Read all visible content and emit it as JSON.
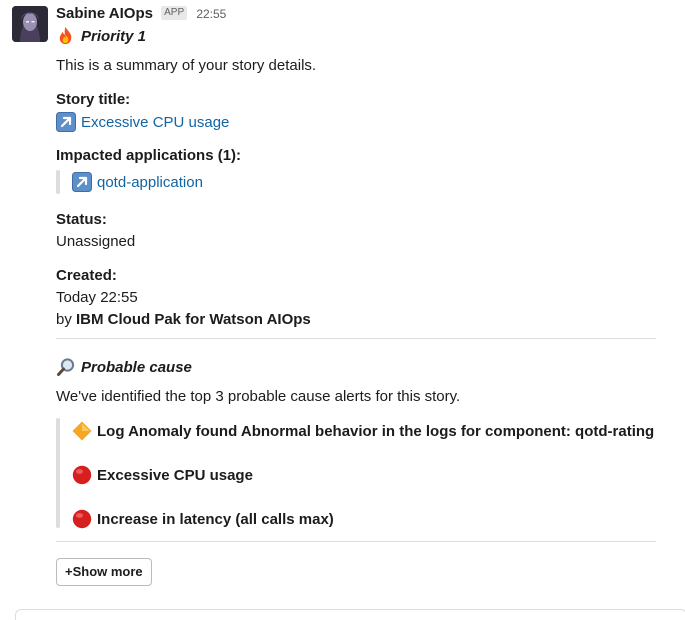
{
  "message": {
    "sender": "Sabine AIOps",
    "badge": "APP",
    "time": "22:55",
    "priority": "Priority 1",
    "intro": "This is a summary of your story details.",
    "story_title_label": "Story title:",
    "story_title": "Excessive CPU usage",
    "impacted_label": "Impacted applications (1):",
    "impacted_apps": [
      "qotd-application"
    ],
    "status_label": "Status:",
    "status": "Unassigned",
    "created_label": "Created:",
    "created_time": "Today 22:55",
    "created_by_prefix": "by",
    "created_by": "IBM Cloud Pak for Watson AIOps",
    "probable_cause_title": "Probable cause",
    "probable_cause_intro": "We've identified the top 3 probable cause alerts for this story.",
    "alerts": [
      {
        "icon": "orange-diamond-icon",
        "text": "Log Anomaly found Abnormal behavior in the logs for component: qotd-rating"
      },
      {
        "icon": "red-circle-icon",
        "text": "Excessive CPU usage"
      },
      {
        "icon": "red-circle-icon",
        "text": "Increase in latency (all calls max)"
      }
    ],
    "show_more": "+Show more"
  },
  "icons": {
    "avatar": "avatar",
    "priority": "fire-icon",
    "link": "arrow-up-right-icon",
    "probable_cause": "magnifying-glass-icon"
  },
  "colors": {
    "link": "#1264a3",
    "text": "#1d1c1d",
    "muted": "#616061",
    "divider": "#dddddd",
    "red": "#d61f1f",
    "orange": "#f5a623",
    "link_icon_bg": "#5d8fc9"
  }
}
